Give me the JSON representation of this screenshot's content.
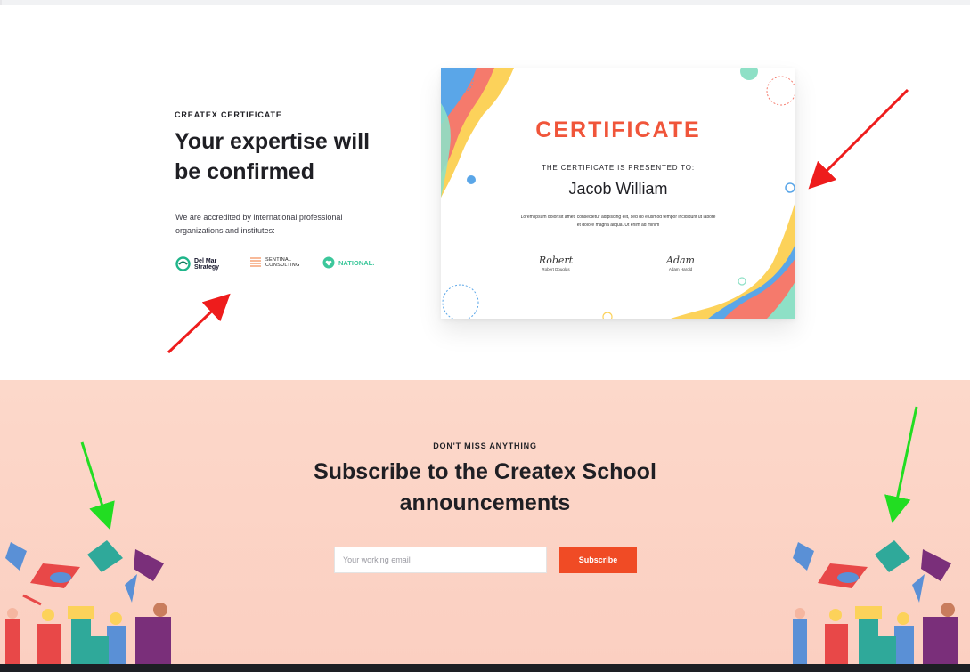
{
  "certificate_section": {
    "eyebrow": "CREATEX CERTIFICATE",
    "title": "Your expertise will be confirmed",
    "description": "We are accredited by international professional organizations and institutes:",
    "partners": [
      {
        "line1": "Del Mar",
        "line2": "Strategy",
        "icon": "del-mar-logo-icon"
      },
      {
        "line1": "SENTINAL",
        "line2": "CONSULTING",
        "icon": "sentinal-logo-icon"
      },
      {
        "line1": "NATIONAL.",
        "icon": "national-heart-logo-icon"
      }
    ]
  },
  "certificate_card": {
    "title": "CERTIFICATE",
    "subtitle": "THE CERTIFICATE IS PRESENTED TO:",
    "recipient": "Jacob William",
    "body": "Lorem ipsum dolor sit amet, consectetur adipiscing elit, sed do eiusmod tempor incididunt ut labore et dolore magna aliqua. Ut enim ad minim",
    "signatures": [
      {
        "hand": "Robert",
        "name": "Robert Douglas"
      },
      {
        "hand": "Adam",
        "name": "Adam Harold"
      }
    ]
  },
  "subscribe_section": {
    "eyebrow": "DON'T MISS ANYTHING",
    "title_line1": "Subscribe to the Createx School",
    "title_line2": "announcements",
    "email_placeholder": "Your working email",
    "button_label": "Subscribe"
  },
  "colors": {
    "accent": "#f04b25",
    "cert_title": "#f0553a",
    "subscribe_bg": "#fcd8ca",
    "annotation_red": "#ee1c1c",
    "annotation_green": "#22dd22"
  }
}
